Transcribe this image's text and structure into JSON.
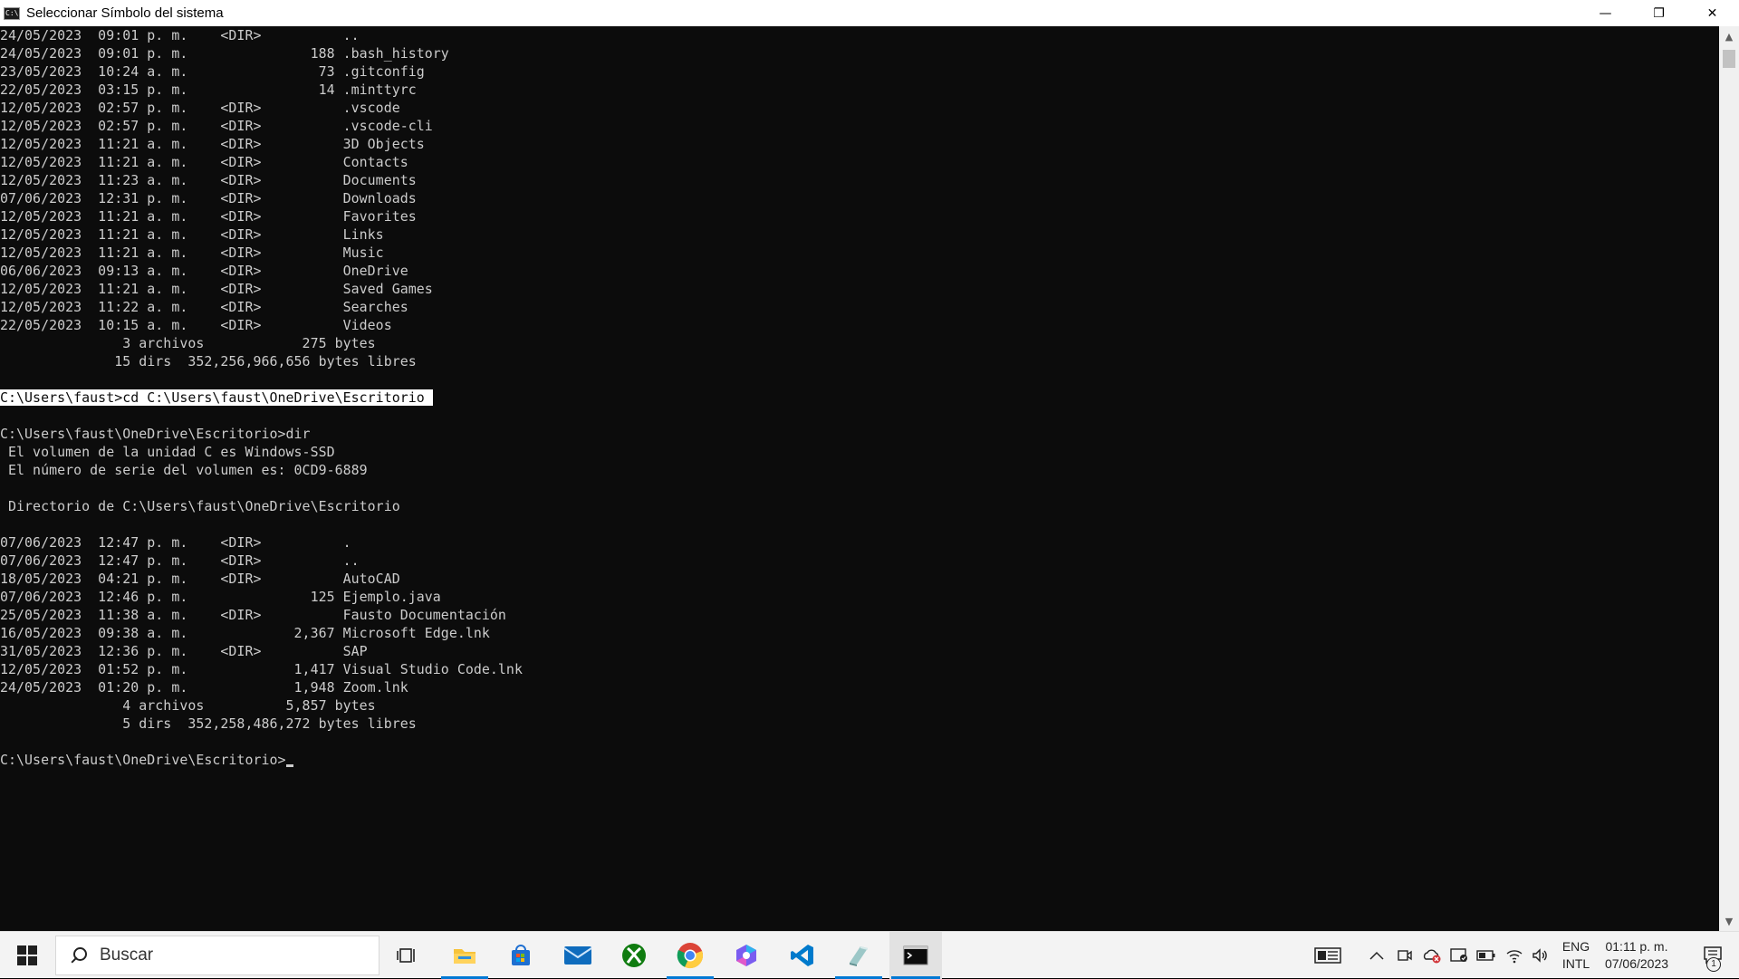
{
  "window": {
    "title": "Seleccionar Símbolo del sistema",
    "icon": "cmd-icon",
    "icon_text": "C:\\",
    "controls": {
      "minimize": "—",
      "restore": "❐",
      "close": "✕"
    }
  },
  "console": {
    "lines_before": [
      "24/05/2023  09:01 p. m.    <DIR>          ..",
      "24/05/2023  09:01 p. m.               188 .bash_history",
      "23/05/2023  10:24 a. m.                73 .gitconfig",
      "22/05/2023  03:15 p. m.                14 .minttyrc",
      "12/05/2023  02:57 p. m.    <DIR>          .vscode",
      "12/05/2023  02:57 p. m.    <DIR>          .vscode-cli",
      "12/05/2023  11:21 a. m.    <DIR>          3D Objects",
      "12/05/2023  11:21 a. m.    <DIR>          Contacts",
      "12/05/2023  11:23 a. m.    <DIR>          Documents",
      "07/06/2023  12:31 p. m.    <DIR>          Downloads",
      "12/05/2023  11:21 a. m.    <DIR>          Favorites",
      "12/05/2023  11:21 a. m.    <DIR>          Links",
      "12/05/2023  11:21 a. m.    <DIR>          Music",
      "06/06/2023  09:13 a. m.    <DIR>          OneDrive",
      "12/05/2023  11:21 a. m.    <DIR>          Saved Games",
      "12/05/2023  11:22 a. m.    <DIR>          Searches",
      "22/05/2023  10:15 a. m.    <DIR>          Videos",
      "               3 archivos            275 bytes",
      "              15 dirs  352,256,966,656 bytes libres",
      ""
    ],
    "selected_line": "C:\\Users\\faust>cd C:\\Users\\faust\\OneDrive\\Escritorio ",
    "lines_after": [
      "",
      "C:\\Users\\faust\\OneDrive\\Escritorio>dir",
      " El volumen de la unidad C es Windows-SSD",
      " El número de serie del volumen es: 0CD9-6889",
      "",
      " Directorio de C:\\Users\\faust\\OneDrive\\Escritorio",
      "",
      "07/06/2023  12:47 p. m.    <DIR>          .",
      "07/06/2023  12:47 p. m.    <DIR>          ..",
      "18/05/2023  04:21 p. m.    <DIR>          AutoCAD",
      "07/06/2023  12:46 p. m.               125 Ejemplo.java",
      "25/05/2023  11:38 a. m.    <DIR>          Fausto Documentación",
      "16/05/2023  09:38 a. m.             2,367 Microsoft Edge.lnk",
      "31/05/2023  12:36 p. m.    <DIR>          SAP",
      "12/05/2023  01:52 p. m.             1,417 Visual Studio Code.lnk",
      "24/05/2023  01:20 p. m.             1,948 Zoom.lnk",
      "               4 archivos          5,857 bytes",
      "               5 dirs  352,258,486,272 bytes libres",
      ""
    ],
    "prompt": "C:\\Users\\faust\\OneDrive\\Escritorio>"
  },
  "scrollbar": {
    "up": "▲",
    "down": "▼"
  },
  "taskbar": {
    "search_placeholder": "Buscar",
    "apps": [
      {
        "name": "task-view",
        "icon": "task-view-icon"
      },
      {
        "name": "file-explorer",
        "icon": "folder-icon"
      },
      {
        "name": "microsoft-store",
        "icon": "store-icon"
      },
      {
        "name": "mail",
        "icon": "mail-icon"
      },
      {
        "name": "xbox",
        "icon": "xbox-icon"
      },
      {
        "name": "chrome",
        "icon": "chrome-icon"
      },
      {
        "name": "copilot",
        "icon": "copilot-icon"
      },
      {
        "name": "vscode",
        "icon": "vscode-icon"
      },
      {
        "name": "sql-tool",
        "icon": "database-icon"
      },
      {
        "name": "command-prompt",
        "icon": "terminal-icon"
      }
    ],
    "tray": {
      "language_top": "ENG",
      "language_bottom": "INTL",
      "time": "01:11 p. m.",
      "date": "07/06/2023",
      "notification_count": "1"
    },
    "colors": {
      "accent": "#0078d4",
      "explorer": "#f6c33b",
      "store": "#1e6fd1",
      "xbox": "#107c10",
      "vscode": "#007acc"
    }
  }
}
